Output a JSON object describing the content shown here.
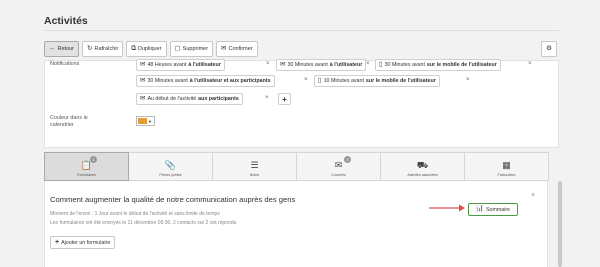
{
  "page_title": "Activités",
  "toolbar": {
    "back": "Retour",
    "refresh": "Rafraîchir",
    "duplicate": "Dupliquer",
    "delete": "Supprimer",
    "confirm": "Confirmer"
  },
  "notifications": {
    "label": "Notifications",
    "chips": [
      {
        "pre": "48 Heures avant ",
        "bold": "à l'utilisateur",
        "icon": "envelope-icon"
      },
      {
        "pre": "30 Minutes avant ",
        "bold": "à l'utilisateur",
        "icon": "envelope-icon"
      },
      {
        "pre": "30 Minutes avant ",
        "bold": "sur le mobile de l'utilisateur",
        "icon": "mobile-icon"
      },
      {
        "pre": "30 Minutes avant ",
        "bold": "à l'utilisateur et aux participants",
        "icon": "envelope-icon"
      },
      {
        "pre": "10 Minutes avant ",
        "bold": "sur le mobile de l'utilisateur",
        "icon": "mobile-icon"
      },
      {
        "pre": "Au début de l'activité ",
        "bold": "aux participants",
        "icon": "envelope-icon"
      }
    ]
  },
  "calendar_color": {
    "label_line1": "Couleur dans le",
    "label_line2": "calendrier",
    "value": "#e59b3a"
  },
  "tabs": [
    {
      "label": "Formulaires",
      "badge": "1",
      "icon": "clipboard-icon",
      "active": true
    },
    {
      "label": "Pièces jointes",
      "badge": "",
      "icon": "paperclip-icon",
      "active": false
    },
    {
      "label": "Notes",
      "badge": "",
      "icon": "notes-icon",
      "active": false
    },
    {
      "label": "Courriels",
      "badge": "2",
      "icon": "envelope-icon",
      "active": false
    },
    {
      "label": "Activités associées",
      "badge": "",
      "icon": "truck-icon",
      "active": false
    },
    {
      "label": "Facturation",
      "badge": "",
      "icon": "cash-register-icon",
      "active": false
    }
  ],
  "form": {
    "title": "Comment augmenter la qualité de notre communication auprès des gens",
    "meta1": "Moment de l'envoi : 1 Jour avant le début de l'activité et sans limite de temps",
    "meta2": "Les formulaires ont été envoyés le 11 décembre 09:30. 2 contacts sur 2 ont répondu",
    "summary_button": "Sommaire",
    "add_button": "Ajouter un formulaire"
  },
  "colors": {
    "arrow": "#e05050",
    "summary_border": "#4a9a4a"
  }
}
